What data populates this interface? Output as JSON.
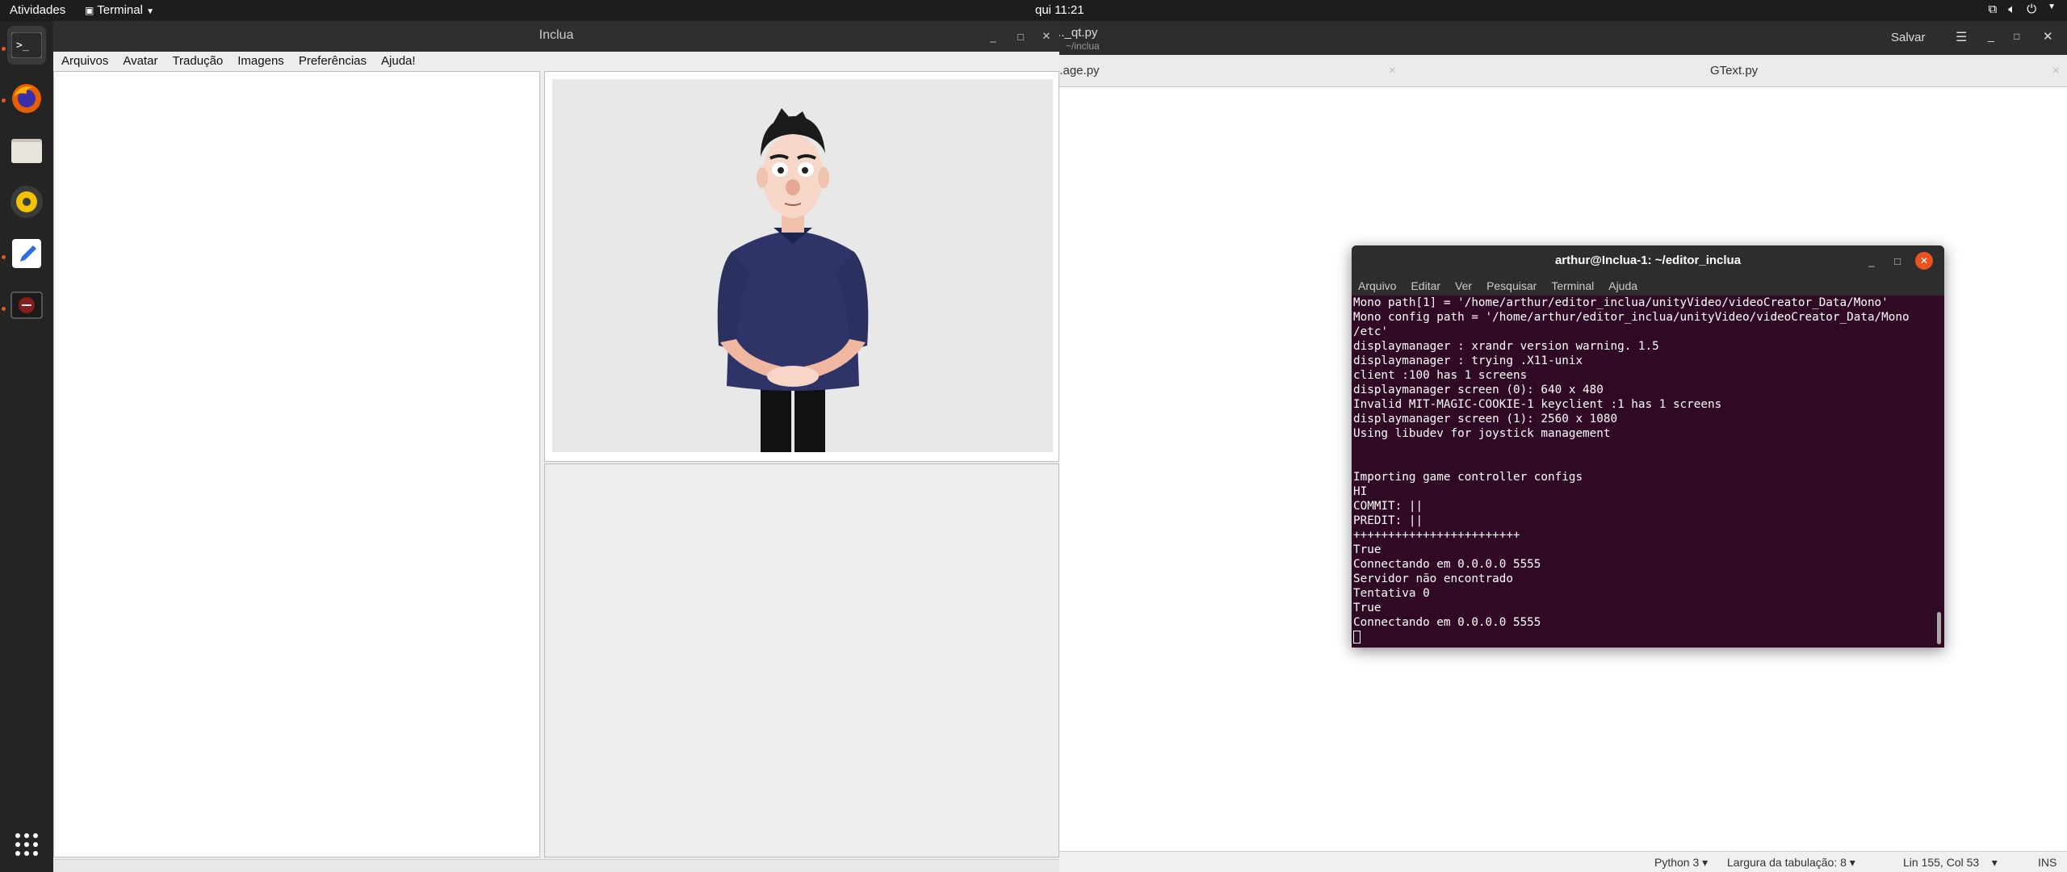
{
  "topbar": {
    "activities": "Atividades",
    "app_name": "Terminal",
    "clock": "qui 11:21"
  },
  "dock": {
    "items": [
      "terminal-icon",
      "firefox-icon",
      "files-icon",
      "rhythmbox-icon",
      "text-editor-icon",
      "recorder-icon",
      "app-grid-icon"
    ]
  },
  "gedit": {
    "title": "..._qt.py",
    "subtitle": "~/inclua",
    "save_label": "Salvar",
    "tabs": [
      "...age.py",
      "GText.py"
    ],
    "status": {
      "language": "Python 3",
      "tab_width": "Largura da tabulação: 8",
      "position": "Lin 155, Col 53",
      "mode": "INS"
    }
  },
  "inclua": {
    "title": "Inclua",
    "menu": [
      "Arquivos",
      "Avatar",
      "Tradução",
      "Imagens",
      "Preferências",
      "Ajuda!"
    ]
  },
  "terminal": {
    "title": "arthur@Inclua-1: ~/editor_inclua",
    "menu": [
      "Arquivo",
      "Editar",
      "Ver",
      "Pesquisar",
      "Terminal",
      "Ajuda"
    ],
    "lines": [
      "Mono path[1] = '/home/arthur/editor_inclua/unityVideo/videoCreator_Data/Mono'",
      "Mono config path = '/home/arthur/editor_inclua/unityVideo/videoCreator_Data/Mono",
      "/etc'",
      "displaymanager : xrandr version warning. 1.5",
      "displaymanager : trying .X11-unix",
      "client :100 has 1 screens",
      "displaymanager screen (0): 640 x 480",
      "Invalid MIT-MAGIC-COOKIE-1 keyclient :1 has 1 screens",
      "displaymanager screen (1): 2560 x 1080",
      "Using libudev for joystick management",
      "",
      "",
      "Importing game controller configs",
      "HI",
      "COMMIT: ||",
      "PREDIT: ||",
      "++++++++++++++++++++++++",
      "True",
      "Connectando em 0.0.0.0 5555",
      "Servidor não encontrado",
      "Tentativa 0",
      "True",
      "Connectando em 0.0.0.0 5555"
    ]
  },
  "colors": {
    "terminal_bg": "#300a24",
    "accent": "#e95420",
    "avatar_shirt": "#2e3468"
  }
}
